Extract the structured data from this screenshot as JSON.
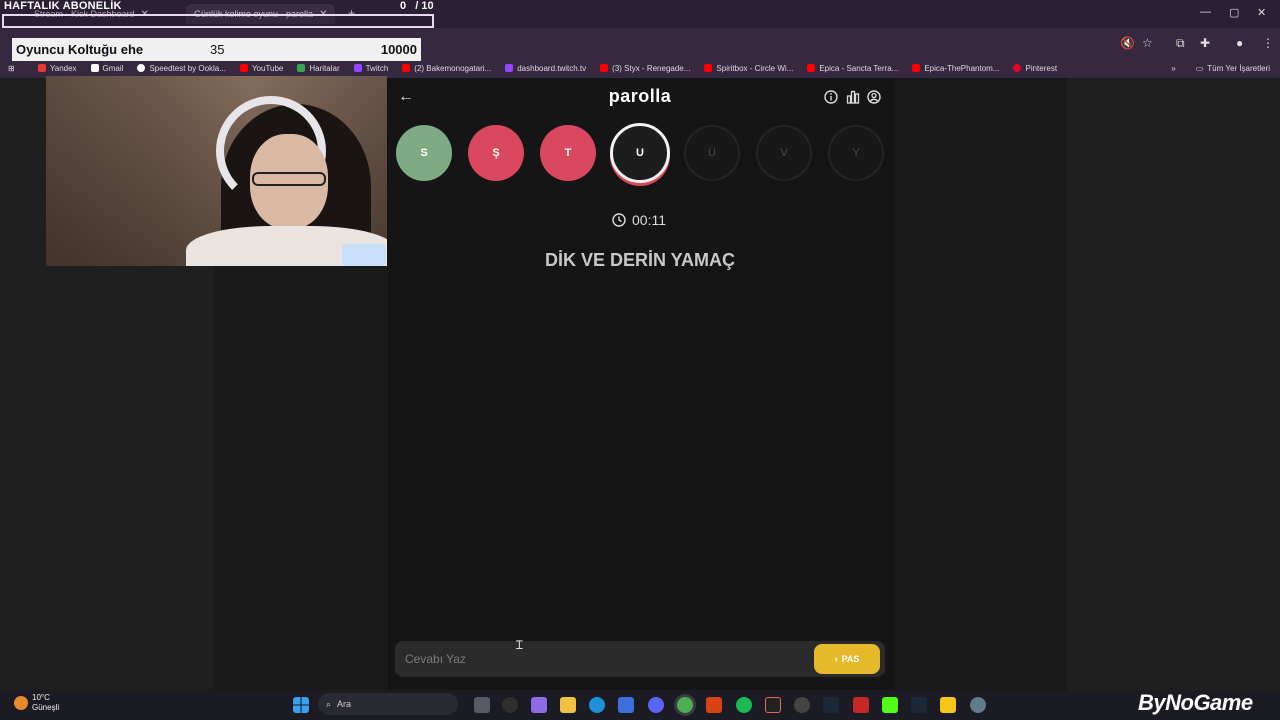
{
  "overlay": {
    "subscription_title": "HAFTALIK ABONELİK",
    "sub_count": "0",
    "sub_total": "/ 10",
    "seat": {
      "name": "Oyuncu Koltuğu ehe",
      "value": "35",
      "goal": "10000"
    }
  },
  "browser": {
    "tabs": [
      {
        "label": "Stream - Kick Dashboard"
      },
      {
        "label": "Günlük kelime oyunu - parolla"
      }
    ],
    "new_tab": "+",
    "bookmarks": [
      {
        "label": "Yandex",
        "color": "#e63b2e"
      },
      {
        "label": "Gmail",
        "color": "#ffffff"
      },
      {
        "label": "Speedtest by Ookla...",
        "color": "#ffffff"
      },
      {
        "label": "YouTube",
        "color": "#ff0000"
      },
      {
        "label": "Haritalar",
        "color": "#34a853"
      },
      {
        "label": "Twitch",
        "color": "#9146ff"
      },
      {
        "label": "(2) Bakemonogatari...",
        "color": "#ff0000"
      },
      {
        "label": "dashboard.twitch.tv",
        "color": "#9146ff"
      },
      {
        "label": "(3) Styx - Renegade...",
        "color": "#ff0000"
      },
      {
        "label": "Spiritbox - Circle Wi...",
        "color": "#ff0000"
      },
      {
        "label": "Epica - Sancta Terra...",
        "color": "#ff0000"
      },
      {
        "label": "Epica-ThePhantom...",
        "color": "#ff0000"
      },
      {
        "label": "Pinterest",
        "color": "#e60023"
      }
    ],
    "all_bookmarks": "Tüm Yer İşaretleri"
  },
  "app": {
    "brand": "parolla",
    "letters": [
      {
        "char": "S",
        "state": "correct"
      },
      {
        "char": "Ş",
        "state": "wrong"
      },
      {
        "char": "T",
        "state": "wrong"
      },
      {
        "char": "U",
        "state": "current"
      },
      {
        "char": "Ü",
        "state": "pending"
      },
      {
        "char": "V",
        "state": "pending"
      },
      {
        "char": "Y",
        "state": "pending"
      }
    ],
    "timer": "00:11",
    "clue": "DİK VE DERİN YAMAÇ",
    "answer_placeholder": "Cevabı Yaz",
    "pass_label": "PAS",
    "colors": {
      "correct": "#7eaa84",
      "wrong": "#d9485e",
      "pass_button": "#e5b929"
    }
  },
  "taskbar": {
    "temperature": "10°C",
    "weather": "Güneşli",
    "search_placeholder": "Ara"
  },
  "watermark": "ByNoGame"
}
